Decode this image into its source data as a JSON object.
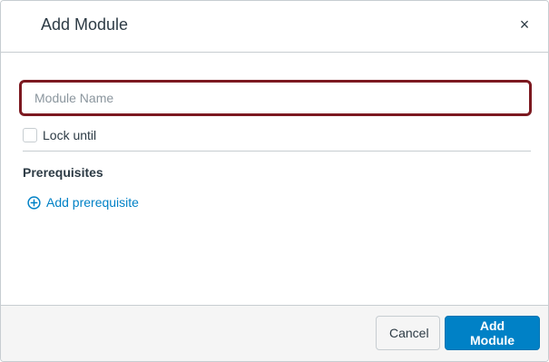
{
  "dialog": {
    "title": "Add Module",
    "close_glyph": "×"
  },
  "form": {
    "module_name_placeholder": "Module Name",
    "module_name_value": "",
    "lock_until_label": "Lock until",
    "lock_until_checked": false,
    "prerequisites_heading": "Prerequisites",
    "add_prerequisite_label": "Add prerequisite",
    "add_prerequisite_icon": "plus-circle-icon"
  },
  "footer": {
    "cancel_label": "Cancel",
    "submit_label": "Add Module"
  },
  "colors": {
    "accent": "#0081c6",
    "focus_border": "#7c1920",
    "text": "#2d3b45"
  }
}
